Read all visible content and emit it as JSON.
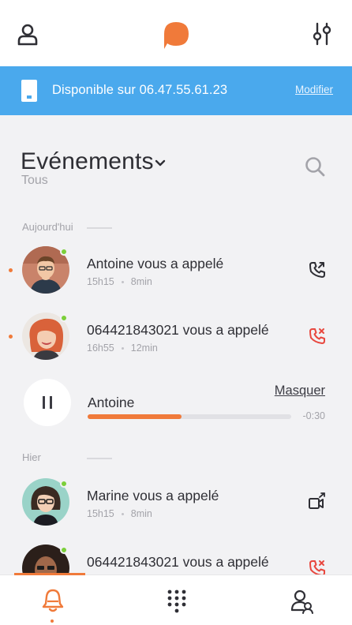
{
  "header": {
    "left_icon": "user-icon",
    "logo": "brand-logo",
    "right_icon": "settings-sliders-icon"
  },
  "banner": {
    "icon": "mobile-phone-icon",
    "text": "Disponible sur 06.47.55.61.23",
    "modify_label": "Modifier"
  },
  "section": {
    "title": "Evénements",
    "filter": "Tous"
  },
  "groups": [
    {
      "label": "Aujourd'hui",
      "events": [
        {
          "name": "Antoine vous a appelé",
          "time": "15h15",
          "duration": "8min",
          "action_icon": "callback-icon"
        },
        {
          "name": "064421843021 vous a appelé",
          "time": "16h55",
          "duration": "12min",
          "action_icon": "missed-call-icon"
        }
      ]
    },
    {
      "label": "Hier",
      "events": [
        {
          "name": "Marine vous a appelé",
          "time": "15h15",
          "duration": "8min",
          "action_icon": "video-call-icon"
        },
        {
          "name": "064421843021 vous a appelé",
          "time": "",
          "duration": "",
          "action_icon": "missed-call-icon"
        }
      ]
    }
  ],
  "player": {
    "name": "Antoine",
    "hide_label": "Masquer",
    "remaining": "-0:30",
    "progress": 0.46
  },
  "tabs": [
    {
      "name": "notifications",
      "icon": "bell-icon",
      "active": true
    },
    {
      "name": "keypad",
      "icon": "keypad-icon",
      "active": false
    },
    {
      "name": "contacts",
      "icon": "contacts-icon",
      "active": false
    }
  ],
  "colors": {
    "accent": "#f07a3a",
    "banner": "#4aa9ed",
    "missed": "#e8483f",
    "online": "#7ccf3a"
  }
}
